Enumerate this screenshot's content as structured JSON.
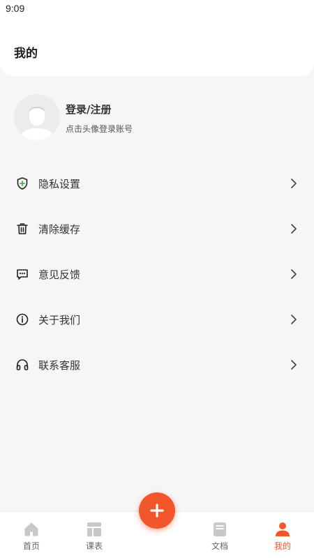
{
  "status": {
    "time": "9:09"
  },
  "header": {
    "title": "我的"
  },
  "profile": {
    "title": "登录/注册",
    "subtitle": "点击头像登录账号"
  },
  "menu": {
    "items": [
      {
        "label": "隐私设置",
        "icon": "shield-plus-icon"
      },
      {
        "label": "清除缓存",
        "icon": "trash-icon"
      },
      {
        "label": "意见反馈",
        "icon": "chat-icon"
      },
      {
        "label": "关于我们",
        "icon": "info-icon"
      },
      {
        "label": "联系客服",
        "icon": "headphones-icon"
      }
    ]
  },
  "tabbar": {
    "items": [
      {
        "label": "首页",
        "icon": "home-icon"
      },
      {
        "label": "课表",
        "icon": "schedule-icon"
      },
      {
        "label": "文档",
        "icon": "document-icon"
      },
      {
        "label": "我的",
        "icon": "user-icon",
        "active": true
      }
    ],
    "fab_icon": "plus-icon"
  },
  "colors": {
    "accent": "#f2562b",
    "inactive": "#c8c8c8",
    "background": "#f6f6f6"
  }
}
